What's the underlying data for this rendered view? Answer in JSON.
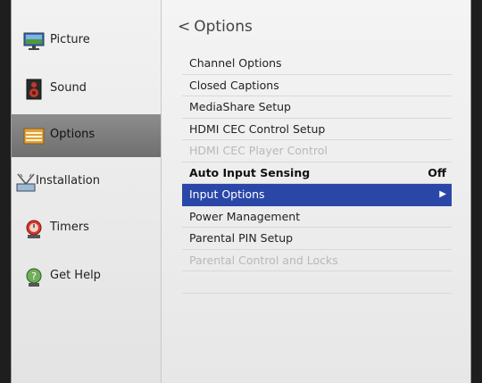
{
  "sidebar": {
    "items": [
      {
        "label": "Picture",
        "icon": "monitor-icon",
        "selected": false
      },
      {
        "label": "Sound",
        "icon": "speaker-icon",
        "selected": false
      },
      {
        "label": "Options",
        "icon": "options-icon",
        "selected": true
      },
      {
        "label": "Installation",
        "icon": "antenna-icon",
        "selected": false
      },
      {
        "label": "Timers",
        "icon": "timer-icon",
        "selected": false
      },
      {
        "label": "Get Help",
        "icon": "help-icon",
        "selected": false
      }
    ]
  },
  "main": {
    "back_glyph": "<",
    "title": "Options",
    "menu": [
      {
        "label": "Channel Options",
        "state": "normal"
      },
      {
        "label": "Closed Captions",
        "state": "normal"
      },
      {
        "label": "MediaShare Setup",
        "state": "normal"
      },
      {
        "label": "HDMI CEC Control Setup",
        "state": "normal"
      },
      {
        "label": "HDMI CEC Player Control",
        "state": "disabled"
      },
      {
        "label": "Auto Input Sensing",
        "state": "bold",
        "value": "Off"
      },
      {
        "label": "Input Options",
        "state": "highlighted",
        "arrow": "▶"
      },
      {
        "label": "Power Management",
        "state": "normal"
      },
      {
        "label": "Parental PIN Setup",
        "state": "normal"
      },
      {
        "label": "Parental Control and Locks",
        "state": "disabled"
      }
    ]
  },
  "colors": {
    "highlight": "#2a47a8",
    "selected_sidebar": "#7d7d7d",
    "background": "#ececec"
  }
}
